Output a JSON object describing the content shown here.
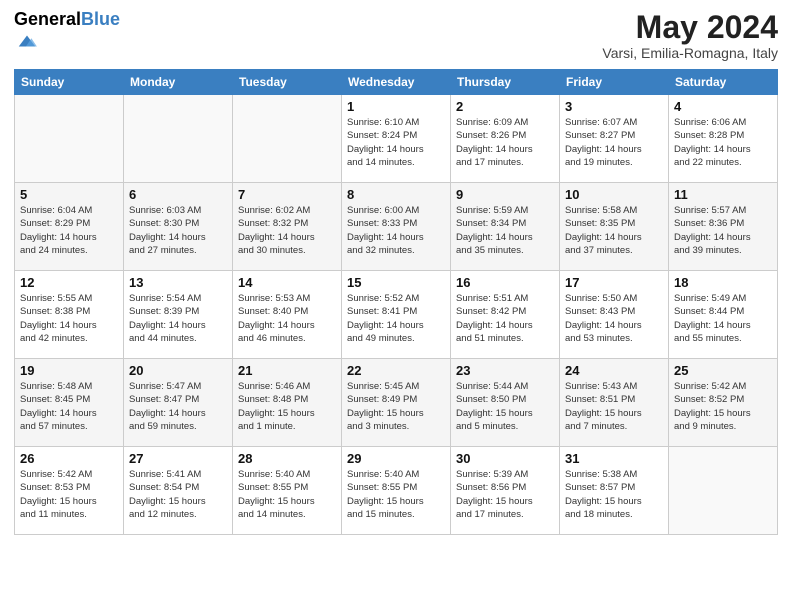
{
  "header": {
    "logo_general": "General",
    "logo_blue": "Blue",
    "title": "May 2024",
    "subtitle": "Varsi, Emilia-Romagna, Italy"
  },
  "columns": [
    "Sunday",
    "Monday",
    "Tuesday",
    "Wednesday",
    "Thursday",
    "Friday",
    "Saturday"
  ],
  "weeks": [
    [
      {
        "day": "",
        "info": ""
      },
      {
        "day": "",
        "info": ""
      },
      {
        "day": "",
        "info": ""
      },
      {
        "day": "1",
        "info": "Sunrise: 6:10 AM\nSunset: 8:24 PM\nDaylight: 14 hours\nand 14 minutes."
      },
      {
        "day": "2",
        "info": "Sunrise: 6:09 AM\nSunset: 8:26 PM\nDaylight: 14 hours\nand 17 minutes."
      },
      {
        "day": "3",
        "info": "Sunrise: 6:07 AM\nSunset: 8:27 PM\nDaylight: 14 hours\nand 19 minutes."
      },
      {
        "day": "4",
        "info": "Sunrise: 6:06 AM\nSunset: 8:28 PM\nDaylight: 14 hours\nand 22 minutes."
      }
    ],
    [
      {
        "day": "5",
        "info": "Sunrise: 6:04 AM\nSunset: 8:29 PM\nDaylight: 14 hours\nand 24 minutes."
      },
      {
        "day": "6",
        "info": "Sunrise: 6:03 AM\nSunset: 8:30 PM\nDaylight: 14 hours\nand 27 minutes."
      },
      {
        "day": "7",
        "info": "Sunrise: 6:02 AM\nSunset: 8:32 PM\nDaylight: 14 hours\nand 30 minutes."
      },
      {
        "day": "8",
        "info": "Sunrise: 6:00 AM\nSunset: 8:33 PM\nDaylight: 14 hours\nand 32 minutes."
      },
      {
        "day": "9",
        "info": "Sunrise: 5:59 AM\nSunset: 8:34 PM\nDaylight: 14 hours\nand 35 minutes."
      },
      {
        "day": "10",
        "info": "Sunrise: 5:58 AM\nSunset: 8:35 PM\nDaylight: 14 hours\nand 37 minutes."
      },
      {
        "day": "11",
        "info": "Sunrise: 5:57 AM\nSunset: 8:36 PM\nDaylight: 14 hours\nand 39 minutes."
      }
    ],
    [
      {
        "day": "12",
        "info": "Sunrise: 5:55 AM\nSunset: 8:38 PM\nDaylight: 14 hours\nand 42 minutes."
      },
      {
        "day": "13",
        "info": "Sunrise: 5:54 AM\nSunset: 8:39 PM\nDaylight: 14 hours\nand 44 minutes."
      },
      {
        "day": "14",
        "info": "Sunrise: 5:53 AM\nSunset: 8:40 PM\nDaylight: 14 hours\nand 46 minutes."
      },
      {
        "day": "15",
        "info": "Sunrise: 5:52 AM\nSunset: 8:41 PM\nDaylight: 14 hours\nand 49 minutes."
      },
      {
        "day": "16",
        "info": "Sunrise: 5:51 AM\nSunset: 8:42 PM\nDaylight: 14 hours\nand 51 minutes."
      },
      {
        "day": "17",
        "info": "Sunrise: 5:50 AM\nSunset: 8:43 PM\nDaylight: 14 hours\nand 53 minutes."
      },
      {
        "day": "18",
        "info": "Sunrise: 5:49 AM\nSunset: 8:44 PM\nDaylight: 14 hours\nand 55 minutes."
      }
    ],
    [
      {
        "day": "19",
        "info": "Sunrise: 5:48 AM\nSunset: 8:45 PM\nDaylight: 14 hours\nand 57 minutes."
      },
      {
        "day": "20",
        "info": "Sunrise: 5:47 AM\nSunset: 8:47 PM\nDaylight: 14 hours\nand 59 minutes."
      },
      {
        "day": "21",
        "info": "Sunrise: 5:46 AM\nSunset: 8:48 PM\nDaylight: 15 hours\nand 1 minute."
      },
      {
        "day": "22",
        "info": "Sunrise: 5:45 AM\nSunset: 8:49 PM\nDaylight: 15 hours\nand 3 minutes."
      },
      {
        "day": "23",
        "info": "Sunrise: 5:44 AM\nSunset: 8:50 PM\nDaylight: 15 hours\nand 5 minutes."
      },
      {
        "day": "24",
        "info": "Sunrise: 5:43 AM\nSunset: 8:51 PM\nDaylight: 15 hours\nand 7 minutes."
      },
      {
        "day": "25",
        "info": "Sunrise: 5:42 AM\nSunset: 8:52 PM\nDaylight: 15 hours\nand 9 minutes."
      }
    ],
    [
      {
        "day": "26",
        "info": "Sunrise: 5:42 AM\nSunset: 8:53 PM\nDaylight: 15 hours\nand 11 minutes."
      },
      {
        "day": "27",
        "info": "Sunrise: 5:41 AM\nSunset: 8:54 PM\nDaylight: 15 hours\nand 12 minutes."
      },
      {
        "day": "28",
        "info": "Sunrise: 5:40 AM\nSunset: 8:55 PM\nDaylight: 15 hours\nand 14 minutes."
      },
      {
        "day": "29",
        "info": "Sunrise: 5:40 AM\nSunset: 8:55 PM\nDaylight: 15 hours\nand 15 minutes."
      },
      {
        "day": "30",
        "info": "Sunrise: 5:39 AM\nSunset: 8:56 PM\nDaylight: 15 hours\nand 17 minutes."
      },
      {
        "day": "31",
        "info": "Sunrise: 5:38 AM\nSunset: 8:57 PM\nDaylight: 15 hours\nand 18 minutes."
      },
      {
        "day": "",
        "info": ""
      }
    ]
  ]
}
